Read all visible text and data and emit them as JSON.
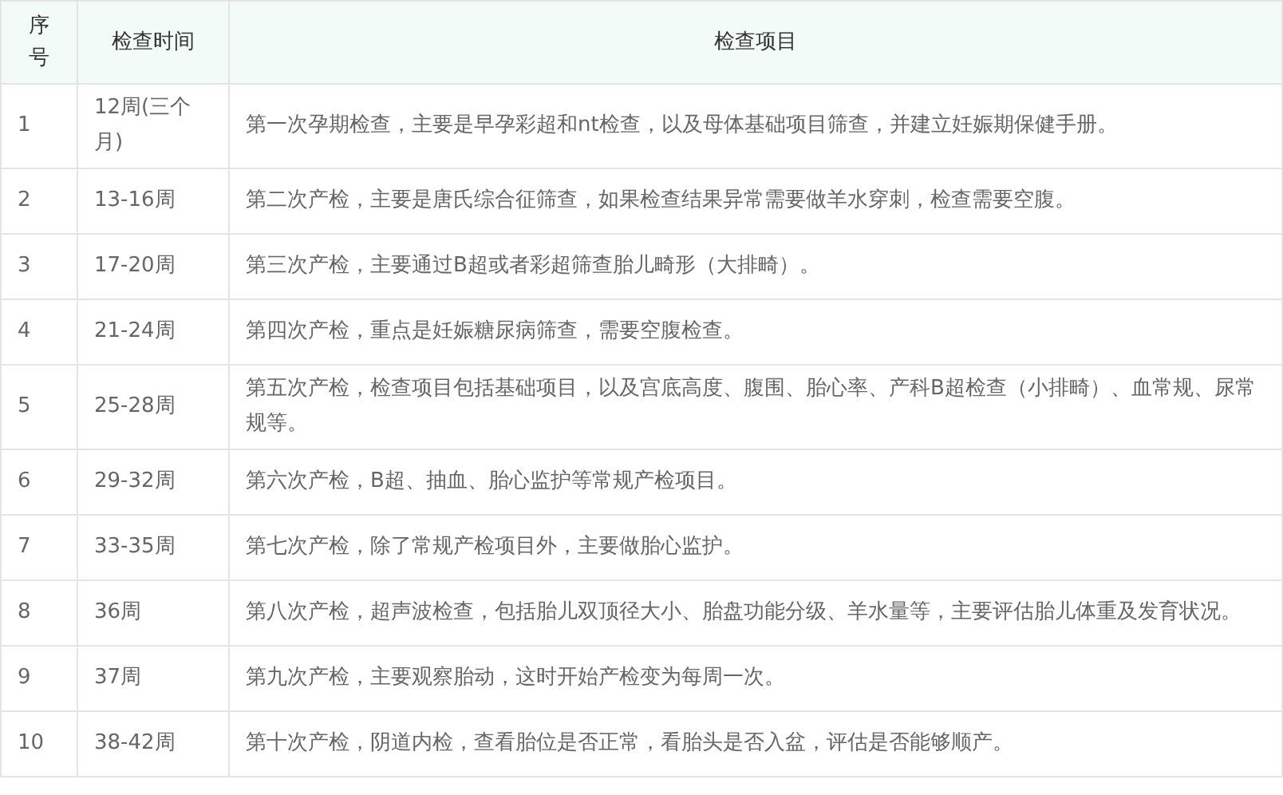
{
  "table": {
    "columns": [
      "序号",
      "检查时间",
      "检查项目"
    ],
    "rows": [
      {
        "index": "1",
        "time": "12周(三个月)",
        "items": "第一次孕期检查，主要是早孕彩超和nt检查，以及母体基础项目筛查，并建立妊娠期保健手册。"
      },
      {
        "index": "2",
        "time": "13-16周",
        "items": "第二次产检，主要是唐氏综合征筛查，如果检查结果异常需要做羊水穿刺，检查需要空腹。"
      },
      {
        "index": "3",
        "time": "17-20周",
        "items": "第三次产检，主要通过B超或者彩超筛查胎儿畸形（大排畸）。"
      },
      {
        "index": "4",
        "time": "21-24周",
        "items": "第四次产检，重点是妊娠糖尿病筛查，需要空腹检查。"
      },
      {
        "index": "5",
        "time": "25-28周",
        "items": "第五次产检，检查项目包括基础项目，以及宫底高度、腹围、胎心率、产科B超检查（小排畸）、血常规、尿常规等。"
      },
      {
        "index": "6",
        "time": "29-32周",
        "items": "第六次产检，B超、抽血、胎心监护等常规产检项目。"
      },
      {
        "index": "7",
        "time": "33-35周",
        "items": "第七次产检，除了常规产检项目外，主要做胎心监护。"
      },
      {
        "index": "8",
        "time": "36周",
        "items": "第八次产检，超声波检查，包括胎儿双顶径大小、胎盘功能分级、羊水量等，主要评估胎儿体重及发育状况。"
      },
      {
        "index": "9",
        "time": "37周",
        "items": "第九次产检，主要观察胎动，这时开始产检变为每周一次。"
      },
      {
        "index": "10",
        "time": "38-42周",
        "items": "第十次产检，阴道内检，查看胎位是否正常，看胎头是否入盆，评估是否能够顺产。"
      }
    ]
  }
}
